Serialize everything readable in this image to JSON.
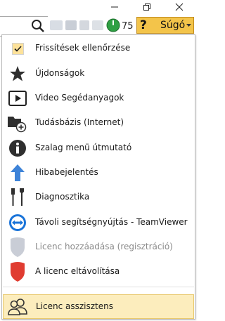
{
  "window": {
    "minimize_icon": "minimize-icon",
    "maximize_icon": "restore-icon",
    "close_icon": "close-icon"
  },
  "toolbar": {
    "counter_value": "75",
    "help": {
      "icon_text": "?",
      "label": "Súgó"
    }
  },
  "menu": {
    "items": [
      {
        "label": "Frissítések ellenőrzése",
        "icon": "checkmark-icon",
        "checked": true,
        "disabled": false
      },
      {
        "label": "Újdonságok",
        "icon": "star-icon",
        "disabled": false
      },
      {
        "label": "Video Segédanyagok",
        "icon": "video-play-icon",
        "disabled": false
      },
      {
        "label": "Tudásbázis (Internet)",
        "icon": "folder-add-icon",
        "disabled": false
      },
      {
        "label": "Szalag menü útmutató",
        "icon": "info-icon",
        "disabled": false
      },
      {
        "label": "Hibabejelentés",
        "icon": "arrow-up-icon",
        "disabled": false
      },
      {
        "label": "Diagnosztika",
        "icon": "tools-icon",
        "disabled": false
      },
      {
        "label": "Távoli segítségnyújtás - TeamViewer",
        "icon": "teamviewer-icon",
        "disabled": false
      },
      {
        "label": "Licenc hozzáadása (regisztráció)",
        "icon": "shield-gray-icon",
        "disabled": true
      },
      {
        "label": "A licenc eltávolítása",
        "icon": "shield-red-icon",
        "disabled": false
      },
      {
        "label": "Licenc asszisztens",
        "icon": "users-icon",
        "disabled": false,
        "hovered": true
      }
    ]
  },
  "colors": {
    "accent": "#f3c44a",
    "hover_bg": "#fcedbd",
    "counter_green": "#2ea043",
    "red_shield": "#e03c31"
  }
}
